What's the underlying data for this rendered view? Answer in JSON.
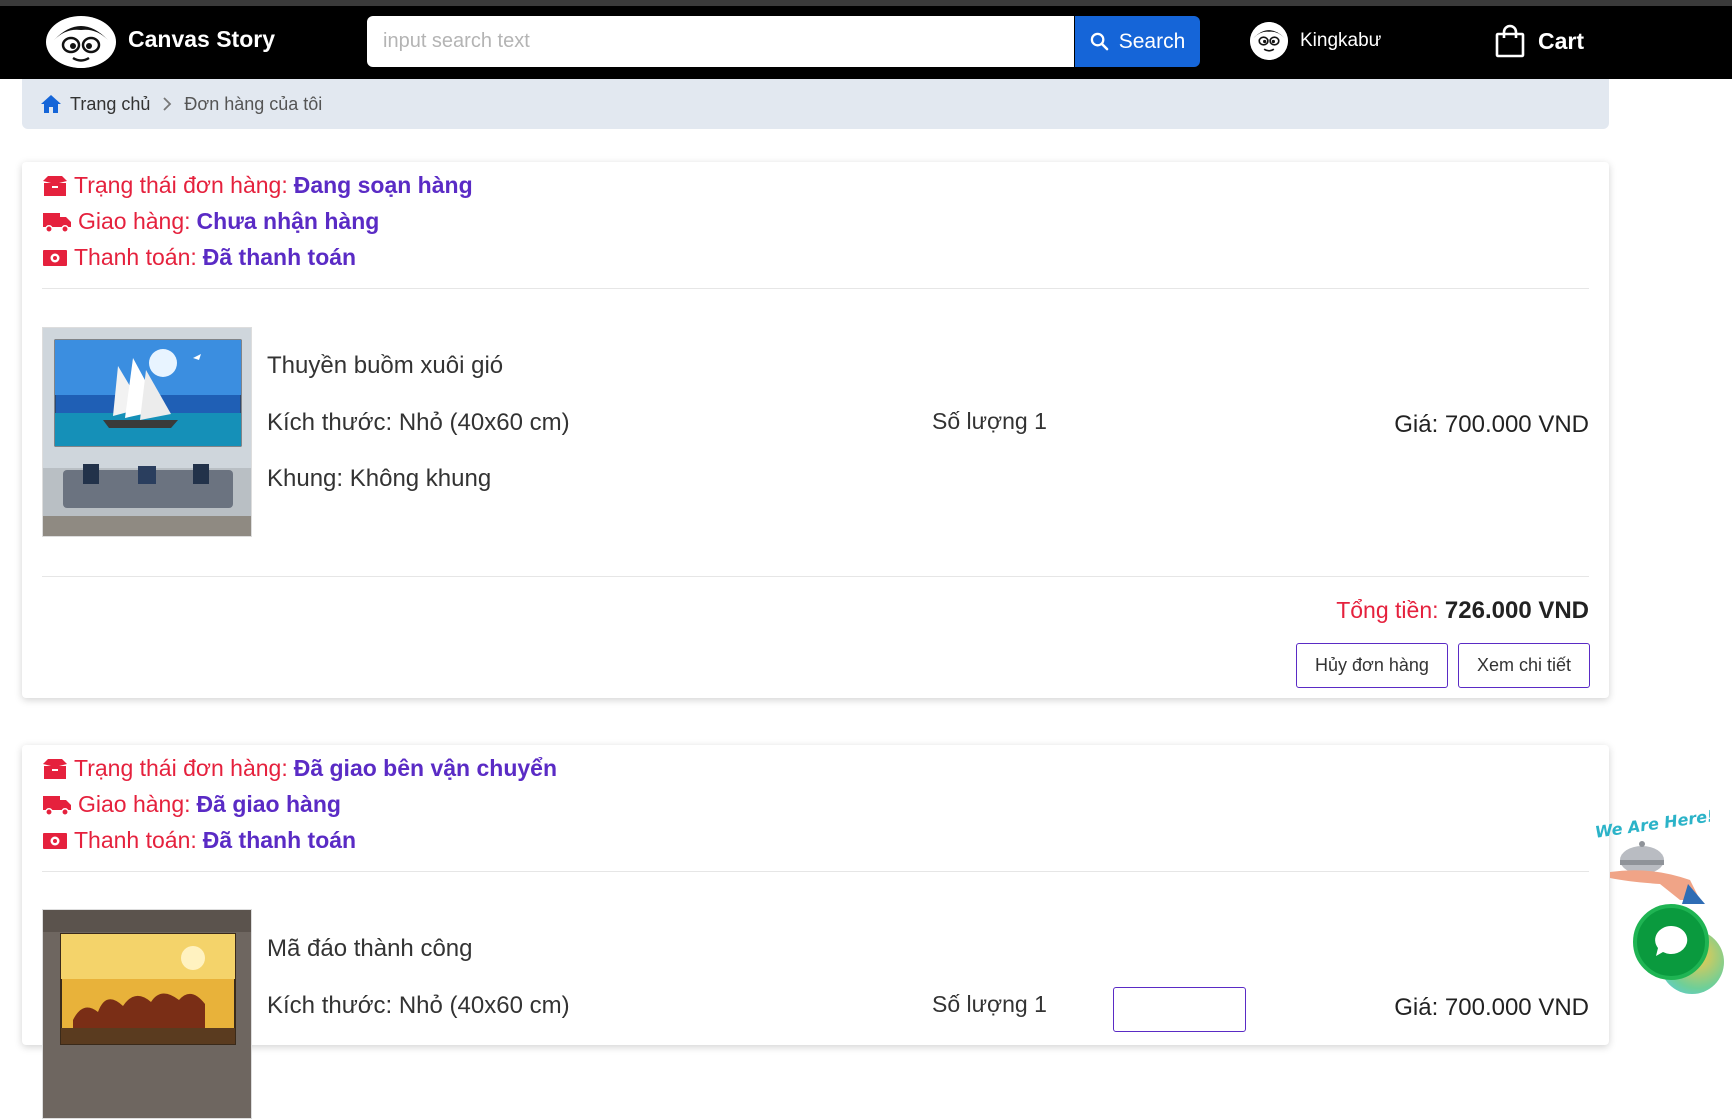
{
  "header": {
    "brand": "Canvas Story",
    "search": {
      "placeholder": "input search text",
      "button_label": "Search"
    },
    "user": {
      "name": "Kingkabư"
    },
    "cart_label": "Cart"
  },
  "breadcrumb": {
    "home": "Trang chủ",
    "current": "Đơn hàng của tôi"
  },
  "orders": [
    {
      "status_label": "Trạng thái đơn hàng:",
      "status_value": "Đang soạn hàng",
      "shipping_label": "Giao hàng:",
      "shipping_value": "Chưa nhận hàng",
      "payment_label": "Thanh toán:",
      "payment_value": "Đã thanh toán",
      "product": {
        "name": "Thuyền buồm xuôi gió",
        "size": "Kích thước: Nhỏ (40x60 cm)",
        "frame": "Khung: Không khung",
        "qty": "Số lượng 1",
        "price": "Giá: 700.000 VND"
      },
      "total_label": "Tổng tiền:",
      "total_value": "726.000 VND",
      "cancel_label": "Hủy đơn hàng",
      "detail_label": "Xem chi tiết"
    },
    {
      "status_label": "Trạng thái đơn hàng:",
      "status_value": "Đã giao bên vận chuyển",
      "shipping_label": "Giao hàng:",
      "shipping_value": "Đã giao hàng",
      "payment_label": "Thanh toán:",
      "payment_value": "Đã thanh toán",
      "product": {
        "name": "Mã đáo thành công",
        "size": "Kích thước: Nhỏ (40x60 cm)",
        "qty": "Số lượng 1",
        "price": "Giá: 700.000 VND"
      }
    }
  ],
  "widget": {
    "badge_text": "We Are Here!"
  },
  "colors": {
    "status_label": "#e5213d",
    "status_value": "#5a2bc5",
    "search_button": "#1565d8",
    "navbar": "#000000"
  },
  "icons": [
    "box-icon",
    "truck-icon",
    "money-icon",
    "home-icon",
    "chevron-right-icon",
    "search-icon",
    "shopping-bag-icon",
    "chat-icon"
  ]
}
